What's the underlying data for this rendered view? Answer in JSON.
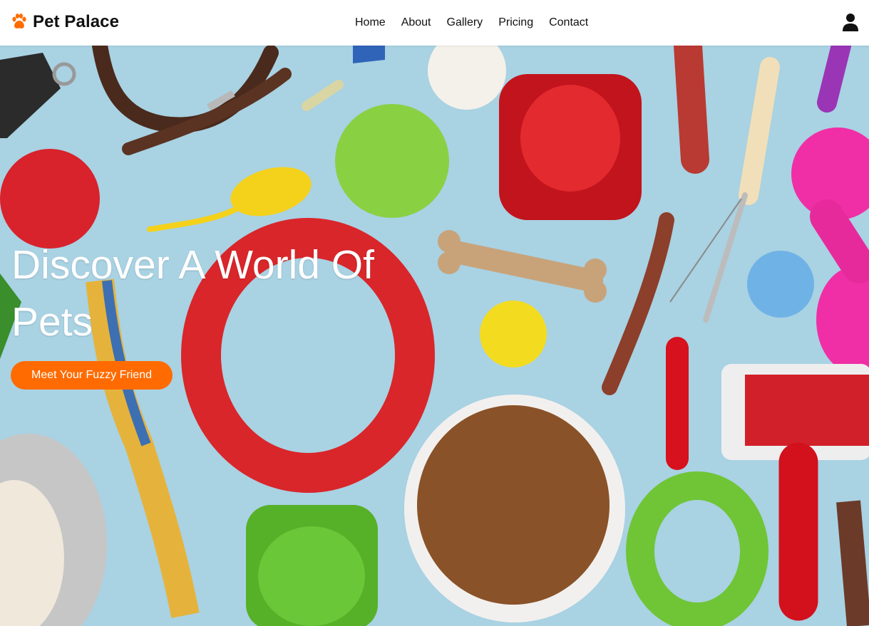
{
  "brand": {
    "name": "Pet Palace",
    "icon": "paw-icon",
    "icon_color": "#ff6b00"
  },
  "nav": {
    "items": [
      {
        "label": "Home"
      },
      {
        "label": "About"
      },
      {
        "label": "Gallery"
      },
      {
        "label": "Pricing"
      },
      {
        "label": "Contact"
      }
    ]
  },
  "header": {
    "user_icon": "user-icon"
  },
  "hero": {
    "title": "Discover A World Of Pets",
    "cta_label": "Meet Your Fuzzy Friend",
    "cta_color": "#ff6b00",
    "background_color": "#a9d2e3"
  }
}
